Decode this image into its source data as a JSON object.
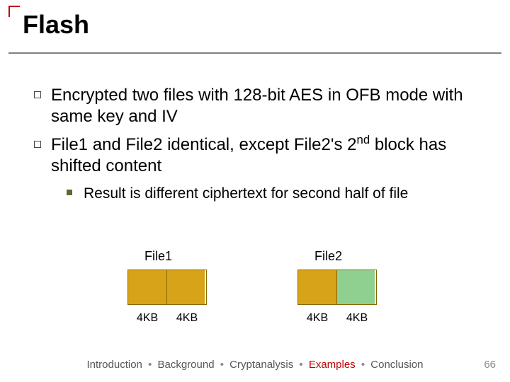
{
  "title": "Flash",
  "bullets": [
    "Encrypted two files with 128-bit AES in OFB mode with same key and IV",
    "File1 and File2 identical, except File2's 2"
  ],
  "bullet2_sup": "nd",
  "bullet2_tail": " block has shifted content",
  "sub_bullet": "Result is different ciphertext for second half of file",
  "file1": {
    "label": "File1",
    "block1": "4KB",
    "block2": "4KB"
  },
  "file2": {
    "label": "File2",
    "block1": "4KB",
    "block2": "4KB"
  },
  "footer": {
    "p1": "Introduction",
    "p2": "Background",
    "p3": "Cryptanalysis",
    "p4": "Examples",
    "p5": "Conclusion"
  },
  "page": "66"
}
